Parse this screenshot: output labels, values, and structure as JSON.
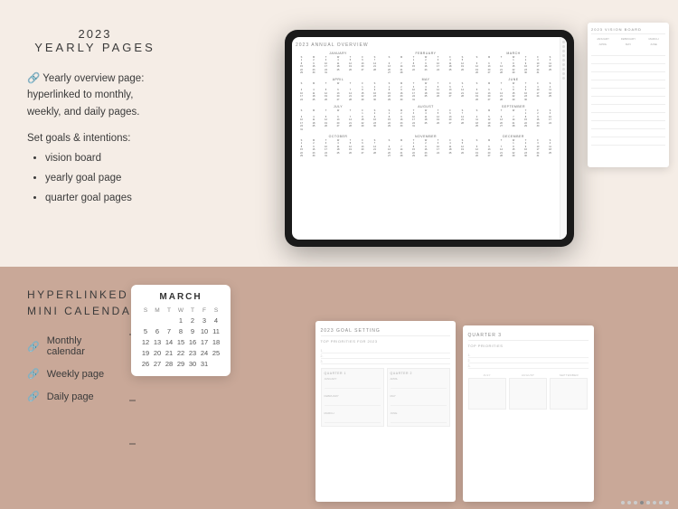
{
  "top": {
    "year": "2023",
    "title": "YEARLY PAGES",
    "feature_hyperlink": "🔗 Yearly overview page: hyperlinked to monthly, weekly, and daily pages.",
    "goals_label": "Set goals & intentions:",
    "bullet_items": [
      "vision board",
      "yearly goal page",
      "quarter goal pages"
    ]
  },
  "tablet": {
    "header": "2023 ANNUAL OVERVIEW",
    "months_row1": [
      "JANUARY",
      "FEBRUARY",
      "MARCH",
      "APRIL",
      "MAY",
      "JUNE"
    ],
    "months_row2": [
      "JULY",
      "AUGUST",
      "SEPTEMBER",
      "OCTOBER",
      "NOVEMBER",
      "DECEMBER"
    ]
  },
  "vision_board": {
    "title": "2023 VISION BOARD",
    "col_labels": [
      "JANUARY",
      "FEBRUARY",
      "MARCH"
    ]
  },
  "bottom": {
    "title_line1": "HYPERLINKED",
    "title_line2": "MINI CALENDARS",
    "items": [
      {
        "icon": "🔗",
        "label": "Monthly\ncalendar"
      },
      {
        "icon": "🔗",
        "label": "Weekly page"
      },
      {
        "icon": "🔗",
        "label": "Daily page"
      }
    ]
  },
  "mini_calendar": {
    "month": "MARCH",
    "headers": [
      "S",
      "M",
      "T",
      "W",
      "T",
      "F",
      "S"
    ],
    "rows": [
      [
        "",
        "",
        "",
        "1",
        "2",
        "3",
        "4",
        "5"
      ],
      [
        "6",
        "7",
        "8",
        "9",
        "10",
        "11",
        "12"
      ],
      [
        "13",
        "14",
        "15",
        "16",
        "17",
        "18",
        "19"
      ],
      [
        "20",
        "21",
        "22",
        "23",
        "24",
        "25",
        "26"
      ],
      [
        "27",
        "28",
        "29",
        "30",
        "31",
        "",
        ""
      ]
    ]
  },
  "goal_page": {
    "title": "2023 GOAL SETTING",
    "priorities_label": "TOP PRIORITIES FOR 2023",
    "numbers": [
      "1.",
      "2.",
      "3."
    ],
    "q_labels": [
      "QUARTER 1",
      "QUARTER 2"
    ],
    "months_q1": [
      "JANUARY",
      "FEBRUARY",
      "MARCH"
    ],
    "months_q2": [
      "APRIL",
      "MAY",
      "JUNE"
    ]
  },
  "quarter_page": {
    "title": "QUARTER 3",
    "priorities_label": "TOP PRIORITIES",
    "months": [
      "JULY",
      "AUGUST",
      "SEPTEMBER"
    ]
  },
  "colors": {
    "top_bg": "#f5ede6",
    "bottom_bg": "#c9a898",
    "text_dark": "#3a3a3a",
    "accent": "#888888"
  }
}
